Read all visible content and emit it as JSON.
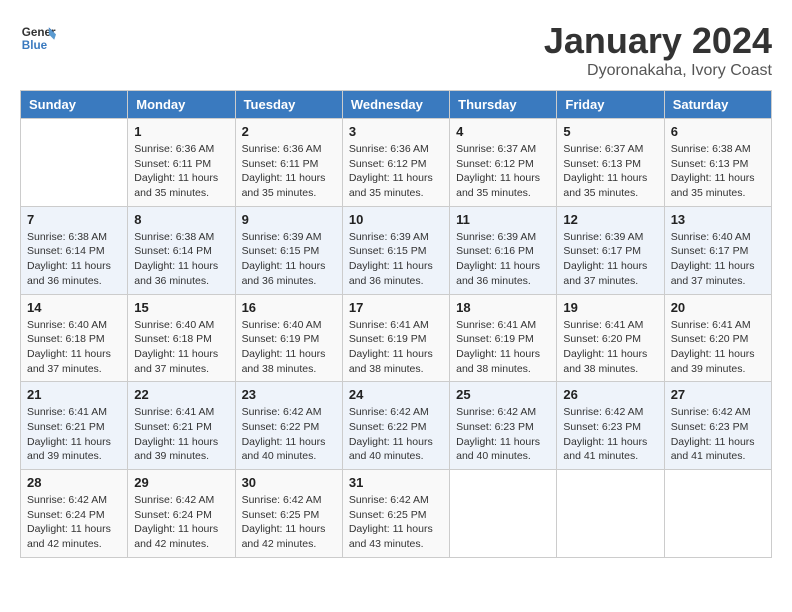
{
  "logo": {
    "text_general": "General",
    "text_blue": "Blue"
  },
  "header": {
    "month_title": "January 2024",
    "subtitle": "Dyoronakaha, Ivory Coast"
  },
  "days_of_week": [
    "Sunday",
    "Monday",
    "Tuesday",
    "Wednesday",
    "Thursday",
    "Friday",
    "Saturday"
  ],
  "weeks": [
    [
      {
        "day": "",
        "sunrise": "",
        "sunset": "",
        "daylight": ""
      },
      {
        "day": "1",
        "sunrise": "Sunrise: 6:36 AM",
        "sunset": "Sunset: 6:11 PM",
        "daylight": "Daylight: 11 hours and 35 minutes."
      },
      {
        "day": "2",
        "sunrise": "Sunrise: 6:36 AM",
        "sunset": "Sunset: 6:11 PM",
        "daylight": "Daylight: 11 hours and 35 minutes."
      },
      {
        "day": "3",
        "sunrise": "Sunrise: 6:36 AM",
        "sunset": "Sunset: 6:12 PM",
        "daylight": "Daylight: 11 hours and 35 minutes."
      },
      {
        "day": "4",
        "sunrise": "Sunrise: 6:37 AM",
        "sunset": "Sunset: 6:12 PM",
        "daylight": "Daylight: 11 hours and 35 minutes."
      },
      {
        "day": "5",
        "sunrise": "Sunrise: 6:37 AM",
        "sunset": "Sunset: 6:13 PM",
        "daylight": "Daylight: 11 hours and 35 minutes."
      },
      {
        "day": "6",
        "sunrise": "Sunrise: 6:38 AM",
        "sunset": "Sunset: 6:13 PM",
        "daylight": "Daylight: 11 hours and 35 minutes."
      }
    ],
    [
      {
        "day": "7",
        "sunrise": "Sunrise: 6:38 AM",
        "sunset": "Sunset: 6:14 PM",
        "daylight": "Daylight: 11 hours and 36 minutes."
      },
      {
        "day": "8",
        "sunrise": "Sunrise: 6:38 AM",
        "sunset": "Sunset: 6:14 PM",
        "daylight": "Daylight: 11 hours and 36 minutes."
      },
      {
        "day": "9",
        "sunrise": "Sunrise: 6:39 AM",
        "sunset": "Sunset: 6:15 PM",
        "daylight": "Daylight: 11 hours and 36 minutes."
      },
      {
        "day": "10",
        "sunrise": "Sunrise: 6:39 AM",
        "sunset": "Sunset: 6:15 PM",
        "daylight": "Daylight: 11 hours and 36 minutes."
      },
      {
        "day": "11",
        "sunrise": "Sunrise: 6:39 AM",
        "sunset": "Sunset: 6:16 PM",
        "daylight": "Daylight: 11 hours and 36 minutes."
      },
      {
        "day": "12",
        "sunrise": "Sunrise: 6:39 AM",
        "sunset": "Sunset: 6:17 PM",
        "daylight": "Daylight: 11 hours and 37 minutes."
      },
      {
        "day": "13",
        "sunrise": "Sunrise: 6:40 AM",
        "sunset": "Sunset: 6:17 PM",
        "daylight": "Daylight: 11 hours and 37 minutes."
      }
    ],
    [
      {
        "day": "14",
        "sunrise": "Sunrise: 6:40 AM",
        "sunset": "Sunset: 6:18 PM",
        "daylight": "Daylight: 11 hours and 37 minutes."
      },
      {
        "day": "15",
        "sunrise": "Sunrise: 6:40 AM",
        "sunset": "Sunset: 6:18 PM",
        "daylight": "Daylight: 11 hours and 37 minutes."
      },
      {
        "day": "16",
        "sunrise": "Sunrise: 6:40 AM",
        "sunset": "Sunset: 6:19 PM",
        "daylight": "Daylight: 11 hours and 38 minutes."
      },
      {
        "day": "17",
        "sunrise": "Sunrise: 6:41 AM",
        "sunset": "Sunset: 6:19 PM",
        "daylight": "Daylight: 11 hours and 38 minutes."
      },
      {
        "day": "18",
        "sunrise": "Sunrise: 6:41 AM",
        "sunset": "Sunset: 6:19 PM",
        "daylight": "Daylight: 11 hours and 38 minutes."
      },
      {
        "day": "19",
        "sunrise": "Sunrise: 6:41 AM",
        "sunset": "Sunset: 6:20 PM",
        "daylight": "Daylight: 11 hours and 38 minutes."
      },
      {
        "day": "20",
        "sunrise": "Sunrise: 6:41 AM",
        "sunset": "Sunset: 6:20 PM",
        "daylight": "Daylight: 11 hours and 39 minutes."
      }
    ],
    [
      {
        "day": "21",
        "sunrise": "Sunrise: 6:41 AM",
        "sunset": "Sunset: 6:21 PM",
        "daylight": "Daylight: 11 hours and 39 minutes."
      },
      {
        "day": "22",
        "sunrise": "Sunrise: 6:41 AM",
        "sunset": "Sunset: 6:21 PM",
        "daylight": "Daylight: 11 hours and 39 minutes."
      },
      {
        "day": "23",
        "sunrise": "Sunrise: 6:42 AM",
        "sunset": "Sunset: 6:22 PM",
        "daylight": "Daylight: 11 hours and 40 minutes."
      },
      {
        "day": "24",
        "sunrise": "Sunrise: 6:42 AM",
        "sunset": "Sunset: 6:22 PM",
        "daylight": "Daylight: 11 hours and 40 minutes."
      },
      {
        "day": "25",
        "sunrise": "Sunrise: 6:42 AM",
        "sunset": "Sunset: 6:23 PM",
        "daylight": "Daylight: 11 hours and 40 minutes."
      },
      {
        "day": "26",
        "sunrise": "Sunrise: 6:42 AM",
        "sunset": "Sunset: 6:23 PM",
        "daylight": "Daylight: 11 hours and 41 minutes."
      },
      {
        "day": "27",
        "sunrise": "Sunrise: 6:42 AM",
        "sunset": "Sunset: 6:23 PM",
        "daylight": "Daylight: 11 hours and 41 minutes."
      }
    ],
    [
      {
        "day": "28",
        "sunrise": "Sunrise: 6:42 AM",
        "sunset": "Sunset: 6:24 PM",
        "daylight": "Daylight: 11 hours and 42 minutes."
      },
      {
        "day": "29",
        "sunrise": "Sunrise: 6:42 AM",
        "sunset": "Sunset: 6:24 PM",
        "daylight": "Daylight: 11 hours and 42 minutes."
      },
      {
        "day": "30",
        "sunrise": "Sunrise: 6:42 AM",
        "sunset": "Sunset: 6:25 PM",
        "daylight": "Daylight: 11 hours and 42 minutes."
      },
      {
        "day": "31",
        "sunrise": "Sunrise: 6:42 AM",
        "sunset": "Sunset: 6:25 PM",
        "daylight": "Daylight: 11 hours and 43 minutes."
      },
      {
        "day": "",
        "sunrise": "",
        "sunset": "",
        "daylight": ""
      },
      {
        "day": "",
        "sunrise": "",
        "sunset": "",
        "daylight": ""
      },
      {
        "day": "",
        "sunrise": "",
        "sunset": "",
        "daylight": ""
      }
    ]
  ]
}
